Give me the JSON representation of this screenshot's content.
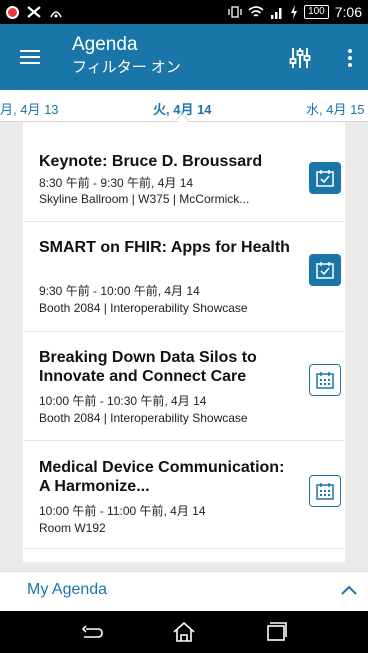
{
  "status_bar": {
    "battery": "100",
    "time": "7:06"
  },
  "app_bar": {
    "title": "Agenda",
    "subtitle": "フィルター オン"
  },
  "date_tabs": {
    "prev": "月, 4月 13",
    "active": "火, 4月 14",
    "next": "水, 4月 15"
  },
  "sessions": [
    {
      "title": "Keynote:  Bruce D. Broussard",
      "time": "8:30 午前 - 9:30 午前, 4月 14",
      "location": "Skyline Ballroom | W375 | McCormick...",
      "added": true
    },
    {
      "title": "SMART on FHIR: Apps for Health",
      "time": "9:30 午前 - 10:00 午前, 4月 14",
      "location": "Booth 2084 | Interoperability Showcase",
      "added": true
    },
    {
      "title": "Breaking Down Data Silos to Innovate and Connect Care",
      "time": "10:00 午前 - 10:30 午前, 4月 14",
      "location": "Booth 2084 | Interoperability Showcase",
      "added": false
    },
    {
      "title": "Medical Device Communication: A Harmonize...",
      "time": "10:00 午前 - 11:00 午前, 4月 14",
      "location": "Room W192",
      "added": false
    }
  ],
  "my_agenda": {
    "label": "My Agenda"
  },
  "colors": {
    "primary": "#1a76a8",
    "background": "#eaeaea"
  }
}
